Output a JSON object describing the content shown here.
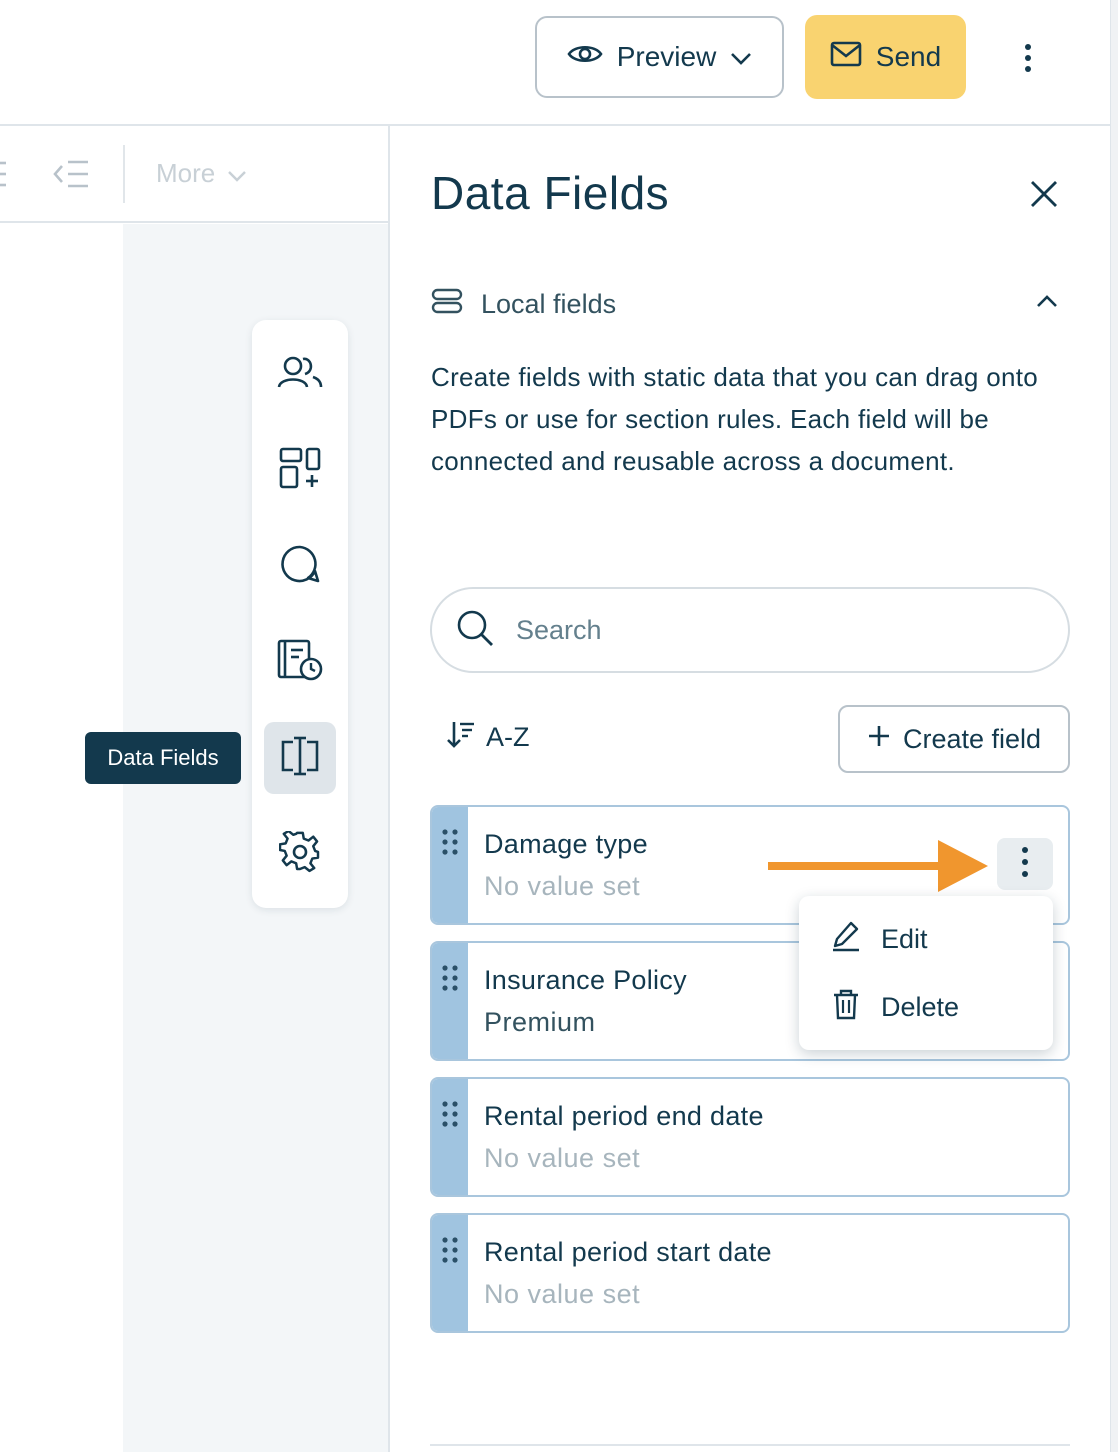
{
  "header": {
    "preview_label": "Preview",
    "send_label": "Send",
    "colors": {
      "send_bg": "#f9d370",
      "text": "#13394d"
    }
  },
  "editor_toolbar": {
    "more_label": "More"
  },
  "rail": {
    "items": [
      {
        "icon": "users-icon"
      },
      {
        "icon": "add-widget-icon"
      },
      {
        "icon": "comment-icon"
      },
      {
        "icon": "history-icon"
      },
      {
        "icon": "data-fields-icon",
        "active": true
      },
      {
        "icon": "settings-gear-icon"
      }
    ],
    "tooltip": "Data Fields"
  },
  "panel": {
    "title": "Data Fields",
    "section_label": "Local fields",
    "description": "Create fields with static data that you can drag onto PDFs or use for section rules. Each field will be connected and reusable across a document.",
    "search_placeholder": "Search",
    "sort_label": "A-Z",
    "create_label": "Create field",
    "fields": [
      {
        "name": "Damage type",
        "value": "No value set"
      },
      {
        "name": "Insurance Policy",
        "value": "Premium"
      },
      {
        "name": "Rental period end date",
        "value": "No value set"
      },
      {
        "name": "Rental period start date",
        "value": "No value set"
      }
    ],
    "context_menu": {
      "edit_label": "Edit",
      "delete_label": "Delete"
    },
    "annotation_arrow_color": "#f0962e"
  }
}
